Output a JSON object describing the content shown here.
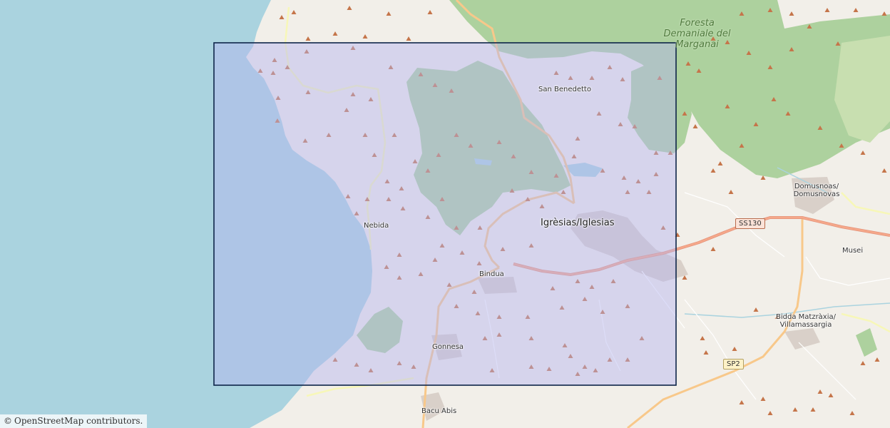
{
  "map": {
    "colors": {
      "sea": "#aad3df",
      "land": "#f2efe9",
      "forest": "#add19e",
      "highlight_fill": "#b4b4f0",
      "highlight_stroke": "#0d2448",
      "primary_road": "#f5a88a",
      "secondary_road": "#f8c88a",
      "minor_road": "#fafac0"
    },
    "places": [
      {
        "key": "san_benedetto",
        "label": "San Benedetto"
      },
      {
        "key": "iglesias",
        "label": "Igrèsias/Iglesias"
      },
      {
        "key": "nebida",
        "label": "Nebida"
      },
      {
        "key": "bindua",
        "label": "Bindua"
      },
      {
        "key": "gonnesa",
        "label": "Gonnesa"
      },
      {
        "key": "bacu_abis",
        "label": "Bacu Abis"
      },
      {
        "key": "domusnovas",
        "label": "Domusnoas/\nDomusnovas"
      },
      {
        "key": "musei",
        "label": "Musei"
      },
      {
        "key": "villamassargia",
        "label": "Bidda Matzràxia/\nVillamassargia"
      }
    ],
    "forest_label": "Foresta\nDemaniale\ndel Marganai",
    "road_shields": [
      {
        "key": "ss130",
        "label": "SS130"
      },
      {
        "key": "sp2",
        "label": "SP2"
      }
    ],
    "icons": [
      "peak-icon"
    ],
    "attribution": {
      "symbol": "©",
      "link_text": "OpenStreetMap",
      "suffix": "contributors."
    }
  }
}
